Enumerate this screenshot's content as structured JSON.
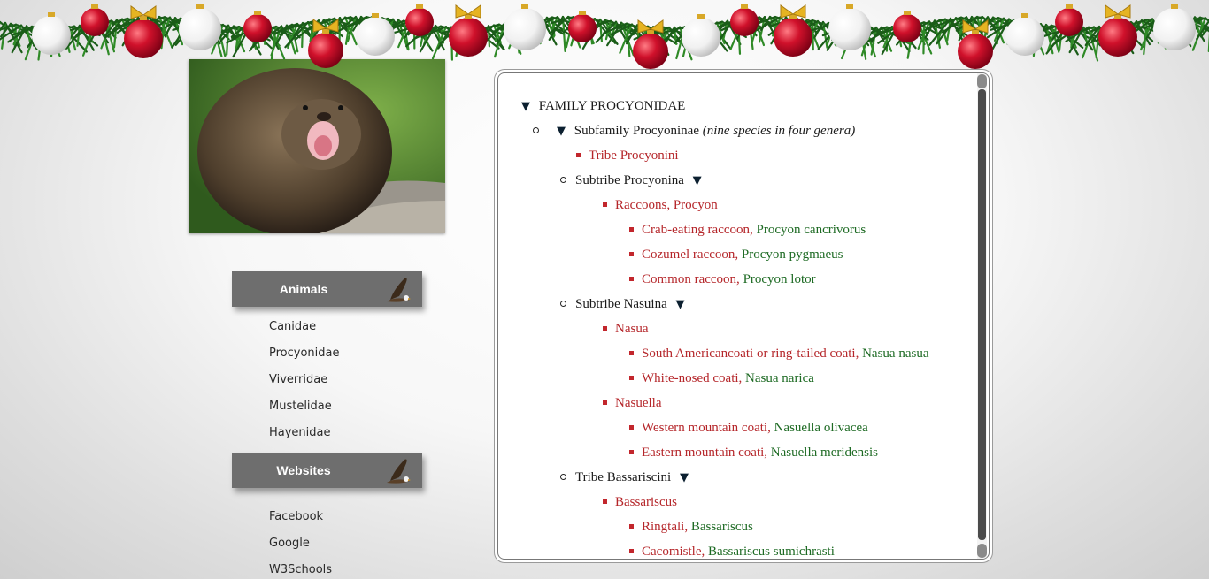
{
  "sidebar": {
    "animals": {
      "title": "Animals",
      "links": [
        "Canidae",
        "Procyonidae",
        "Viverridae",
        "Mustelidae",
        "Hayenidae"
      ]
    },
    "websites": {
      "title": "Websites",
      "links": [
        "Facebook",
        "Google",
        "W3Schools"
      ]
    }
  },
  "tree": {
    "family": "FAMILY PROCYONIDAE",
    "subfamily": "Subfamily Procyoninae",
    "subfamily_note": "(nine species in four genera)",
    "tribe_procyonini": "Tribe Procyonini",
    "subtribe_procyonina": "Subtribe Procyonina",
    "raccoons": "Raccoons, Procyon",
    "crab_common": "Crab-eating raccoon,",
    "crab_sci": "Procyon cancrivorus",
    "cozumel_common": "Cozumel raccoon,",
    "cozumel_sci": "Procyon pygmaeus",
    "common_common": "Common raccoon,",
    "common_sci": "Procyon lotor",
    "subtribe_nasuina": "Subtribe Nasuina",
    "nasua": "Nasua",
    "sa_coati_common": "South Americancoati or ring-tailed coati,",
    "sa_coati_sci": "Nasua nasua",
    "wn_coati_common": "White-nosed coati,",
    "wn_coati_sci": "Nasua narica",
    "nasuella": "Nasuella",
    "western_common": "Western mountain coati,",
    "western_sci": "Nasuella olivacea",
    "eastern_common": "Eastern mountain coati,",
    "eastern_sci": "Nasuella meridensis",
    "tribe_bassariscini": "Tribe Bassariscini",
    "bassariscus": "Bassariscus",
    "ringtail_common": "Ringtali,",
    "ringtail_sci": "Bassariscus",
    "cacomistle_common": "Cacomistle,",
    "cacomistle_sci": "Bassariscus sumichrasti"
  },
  "icons": {
    "expand": "triangle-down-icon",
    "section_header_decoration": "eagle-icon"
  },
  "colors": {
    "common_name": "#b5262a",
    "scientific_name": "#1d6a23",
    "header_bg": "#6e6e6e"
  }
}
